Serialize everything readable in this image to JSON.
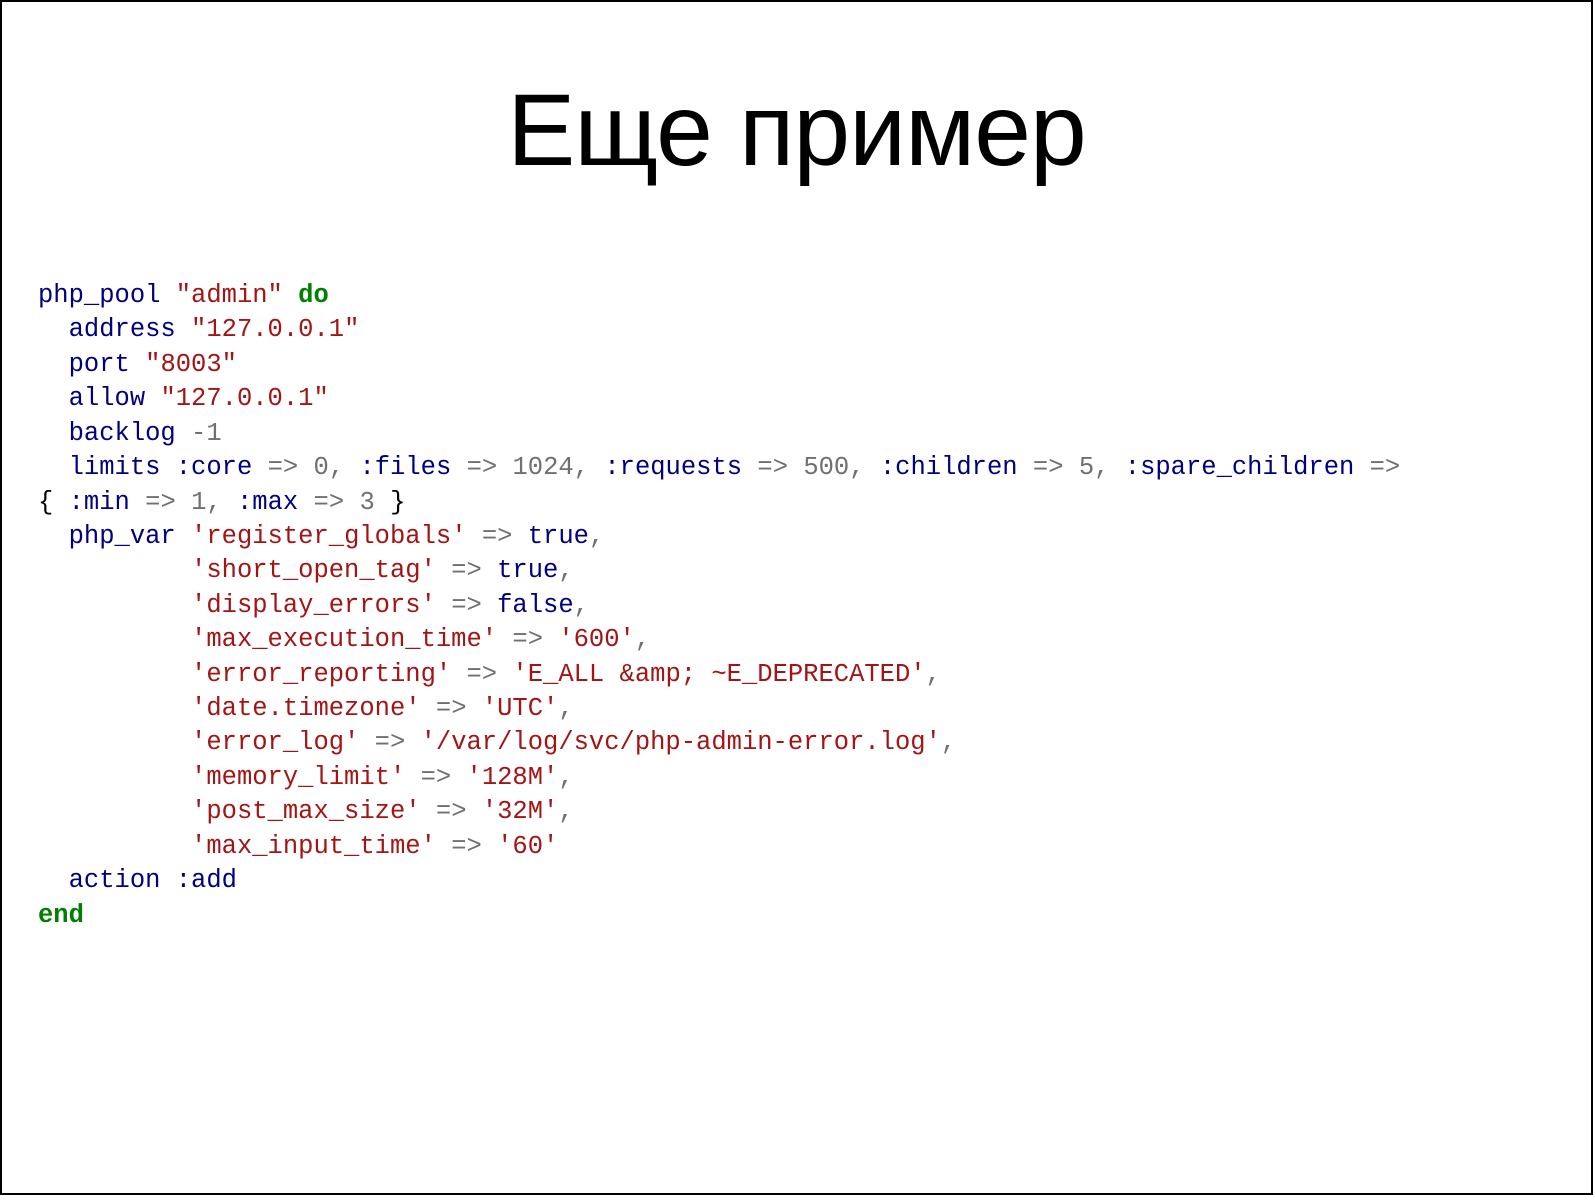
{
  "title": "Еще пример",
  "code": {
    "fn": "php_pool",
    "poolName": "\"admin\"",
    "do": "do",
    "address": {
      "k": "address",
      "v": "\"127.0.0.1\""
    },
    "port": {
      "k": "port",
      "v": "\"8003\""
    },
    "allow": {
      "k": "allow",
      "v": "\"127.0.0.1\""
    },
    "backlog": {
      "k": "backlog",
      "v": "-1"
    },
    "limits": {
      "k": "limits",
      "core_sym": ":core",
      "core_v": "0",
      "files_sym": ":files",
      "files_v": "1024",
      "requests_sym": ":requests",
      "requests_v": "500",
      "children_sym": ":children",
      "children_v": "5",
      "spare_sym": ":spare_children",
      "min_sym": ":min",
      "min_v": "1",
      "max_sym": ":max",
      "max_v": "3"
    },
    "phpvar": {
      "k": "php_var",
      "register_globals": {
        "key": "'register_globals'",
        "val": "true"
      },
      "short_open_tag": {
        "key": "'short_open_tag'",
        "val": "true"
      },
      "display_errors": {
        "key": "'display_errors'",
        "val": "false"
      },
      "max_execution_time": {
        "key": "'max_execution_time'",
        "val": "'600'"
      },
      "error_reporting": {
        "key": "'error_reporting'",
        "val": "'E_ALL &amp; ~E_DEPRECATED'"
      },
      "date_timezone": {
        "key": "'date.timezone'",
        "val": "'UTC'"
      },
      "error_log": {
        "key": "'error_log'",
        "val": "'/var/log/svc/php-admin-error.log'"
      },
      "memory_limit": {
        "key": "'memory_limit'",
        "val": "'128M'"
      },
      "post_max_size": {
        "key": "'post_max_size'",
        "val": "'32M'"
      },
      "max_input_time": {
        "key": "'max_input_time'",
        "val": "'60'"
      }
    },
    "action": {
      "k": "action",
      "sym": ":add"
    },
    "end": "end",
    "arrow": "=>",
    "comma": ","
  }
}
